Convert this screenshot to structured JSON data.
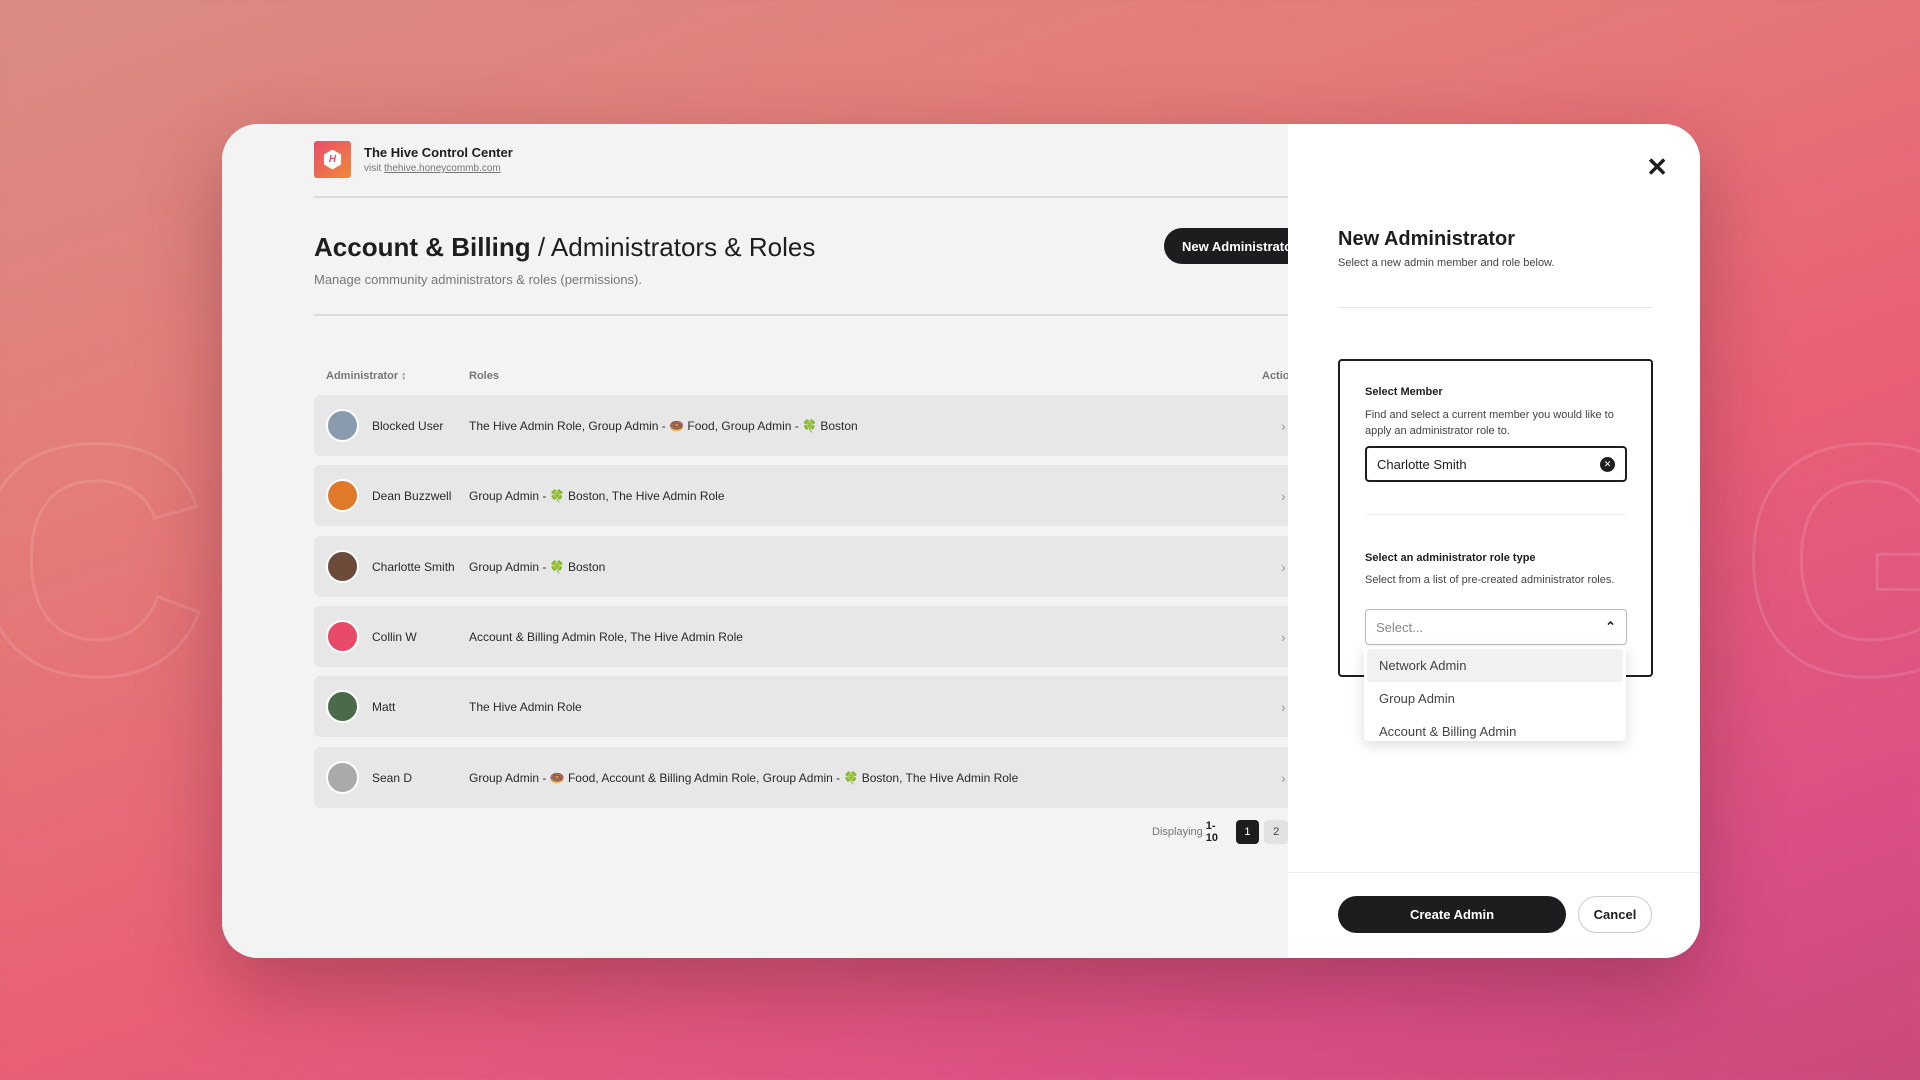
{
  "background": {
    "letters": [
      "C",
      "G"
    ]
  },
  "brand": {
    "title": "The Hive Control Center",
    "visit_label": "visit",
    "link": "thehive.honeycommb.com",
    "logo_text": "H"
  },
  "header": {
    "title_bold": "Account & Billing",
    "title_separator": " / ",
    "title_rest": "Administrators & Roles",
    "description": "Manage community administrators & roles (permissions).",
    "new_admin_button": "New Administrator"
  },
  "table": {
    "columns": {
      "administrator": "Administrator ↕",
      "roles": "Roles",
      "actions": "Actions"
    },
    "rows": [
      {
        "name": "Blocked User",
        "roles": "The Hive Admin Role, Group Admin - 🍩 Food, Group Admin - 🍀 Boston",
        "avatar_color": "#8a9bb0"
      },
      {
        "name": "Dean Buzzwell",
        "roles": "Group Admin - 🍀 Boston, The Hive Admin Role",
        "avatar_color": "#e07a2a"
      },
      {
        "name": "Charlotte Smith",
        "roles": "Group Admin - 🍀 Boston",
        "avatar_color": "#6b4a3a"
      },
      {
        "name": "Collin W",
        "roles": "Account & Billing Admin Role, The Hive Admin Role",
        "avatar_color": "#e94a6a"
      },
      {
        "name": "Matt",
        "roles": "The Hive Admin Role",
        "avatar_color": "#4a6a4a"
      },
      {
        "name": "Sean D",
        "roles": "Group Admin - 🍩 Food, Account & Billing Admin Role, Group Admin - 🍀 Boston, The Hive Admin Role",
        "avatar_color": "#aaaaaa"
      }
    ]
  },
  "pagination": {
    "label": "Displaying",
    "range": "1-10",
    "pages": [
      "1",
      "2"
    ],
    "current": "1"
  },
  "panel": {
    "title": "New Administrator",
    "subtitle": "Select a new admin member and role below.",
    "member_label": "Select Member",
    "member_help": "Find and select a current member you would like to apply an administrator role to.",
    "member_value": "Charlotte Smith",
    "role_label": "Select an administrator role type",
    "role_help": "Select from a list of pre-created administrator roles.",
    "role_placeholder": "Select...",
    "role_options": [
      "Network Admin",
      "Group Admin",
      "Account & Billing Admin"
    ],
    "create_button": "Create Admin",
    "cancel_button": "Cancel"
  }
}
